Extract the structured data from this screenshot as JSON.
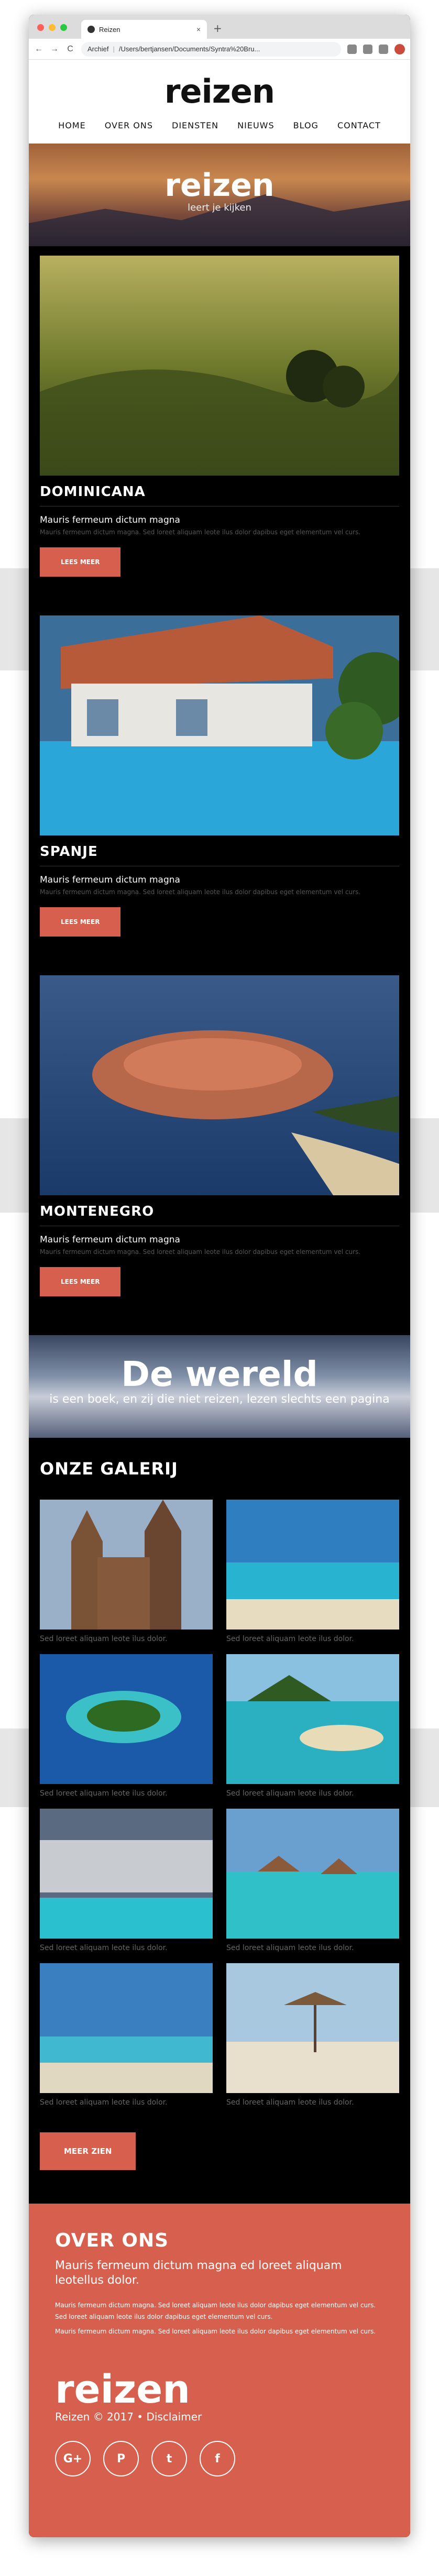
{
  "browser": {
    "tab_title": "Reizen",
    "tab_close": "×",
    "new_tab": "+",
    "back": "←",
    "forward": "→",
    "reload": "C",
    "url_label": "Archief",
    "url_path": "/Users/bertjansen/Documents/Syntra%20Bru..."
  },
  "site": {
    "logo": "reizen",
    "nav": [
      "HOME",
      "OVER ONS",
      "DIENSTEN",
      "NIEUWS",
      "BLOG",
      "CONTACT"
    ]
  },
  "hero": {
    "title": "reizen",
    "subtitle": "leert je kijken"
  },
  "destinations": [
    {
      "title": "DOMINICANA",
      "heading": "Mauris fermeum dictum magna",
      "text": "Mauris fermeum dictum magna. Sed loreet aliquam leote ilus dolor dapibus eget elementum vel curs.",
      "button": "LEES MEER"
    },
    {
      "title": "SPANJE",
      "heading": "Mauris fermeum dictum magna",
      "text": "Mauris fermeum dictum magna. Sed loreet aliquam leote ilus dolor dapibus eget elementum vel curs.",
      "button": "LEES MEER"
    },
    {
      "title": "MONTENEGRO",
      "heading": "Mauris fermeum dictum magna",
      "text": "Mauris fermeum dictum magna. Sed loreet aliquam leote ilus dolor dapibus eget elementum vel curs.",
      "button": "LEES MEER"
    }
  ],
  "world": {
    "title": "De wereld",
    "subtitle": "is een boek, en zij die niet reizen, lezen slechts een pagina"
  },
  "gallery": {
    "title": "ONZE GALERIJ",
    "items": [
      "Sed loreet aliquam leote ilus dolor.",
      "Sed loreet aliquam leote ilus dolor.",
      "Sed loreet aliquam leote ilus dolor.",
      "Sed loreet aliquam leote ilus dolor.",
      "Sed loreet aliquam leote ilus dolor.",
      "Sed loreet aliquam leote ilus dolor.",
      "Sed loreet aliquam leote ilus dolor.",
      "Sed loreet aliquam leote ilus dolor."
    ],
    "button": "MEER ZIEN"
  },
  "footer": {
    "title": "OVER ONS",
    "lead": "Mauris fermeum dictum magna ed loreet aliquam leotellus dolor.",
    "p1": "Mauris fermeum dictum magna. Sed loreet aliquam leote ilus dolor dapibus eget elementum vel curs. Sed loreet aliquam leote ilus dolor dapibus eget elementum vel curs.",
    "p2": "Mauris fermeum dictum magna. Sed loreet aliquam leote ilus dolor dapibus eget elementum vel curs.",
    "logo": "reizen",
    "copyright": "Reizen © 2017 • Disclaimer",
    "socials": [
      "G+",
      "P",
      "t",
      "f"
    ]
  },
  "colors": {
    "accent": "#d6604d",
    "page_bg": "#000000"
  }
}
